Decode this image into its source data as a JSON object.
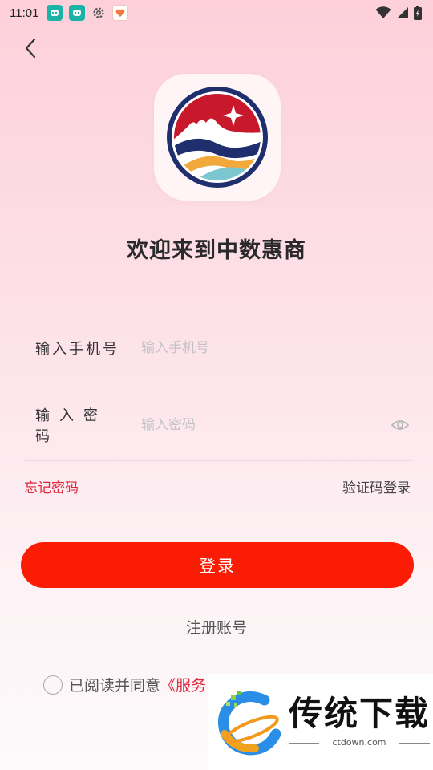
{
  "status_bar": {
    "time": "11:01",
    "icons": [
      "app-icon-teal",
      "app-icon-teal",
      "gear-icon",
      "heart-app-icon",
      "wifi-icon",
      "signal-icon",
      "battery-icon"
    ]
  },
  "header": {
    "back_icon": "chevron-left-icon"
  },
  "app": {
    "welcome": "欢迎来到中数惠商"
  },
  "form": {
    "phone_label": "输入手机号",
    "phone_placeholder": "输入手机号",
    "phone_value": "",
    "password_label": "输入密码",
    "password_placeholder": "输入密码",
    "password_value": "",
    "eye_icon": "eye-icon"
  },
  "links": {
    "forgot_password": "忘记密码",
    "code_login": "验证码登录",
    "register": "注册账号"
  },
  "login_button": "登录",
  "agreement": {
    "text": "已阅读并同意",
    "link": "《服务",
    "checked": false
  },
  "watermark": {
    "title": "传统下载",
    "url": "ctdown.com"
  },
  "colors": {
    "accent_red": "#fb1c06",
    "link_red": "#e0263c",
    "background_top": "#fdd0da",
    "background_bottom": "#fdfafb"
  }
}
